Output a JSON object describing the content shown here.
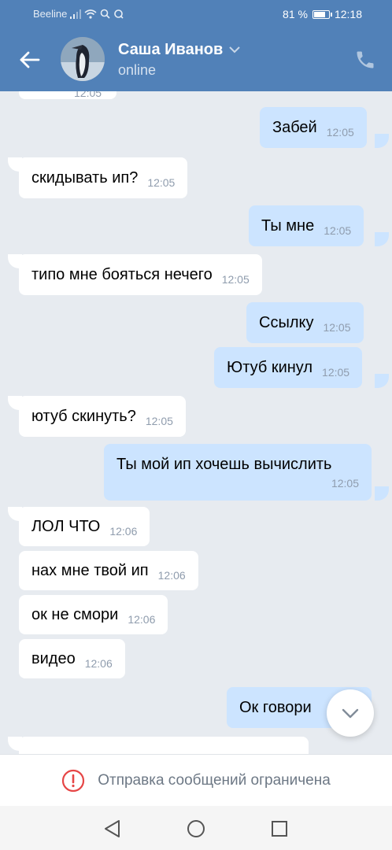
{
  "status_bar": {
    "carrier": "Beeline",
    "battery": "81 %",
    "battery_level": 0.81,
    "time": "12:18"
  },
  "header": {
    "contact_name": "Саша Иванов",
    "presence": "online",
    "icons": [
      "back-arrow-icon",
      "chevron-down-icon",
      "phone-icon"
    ]
  },
  "messages": [
    {
      "dir": "in",
      "text": "",
      "time": "12:05",
      "partial": true
    },
    {
      "dir": "out",
      "text": "Забей",
      "time": "12:05"
    },
    {
      "dir": "in",
      "text": "скидывать ип?",
      "time": "12:05"
    },
    {
      "dir": "out",
      "text": "Ты мне",
      "time": "12:05"
    },
    {
      "dir": "in",
      "text": "типо мне бояться нечего",
      "time": "12:05"
    },
    {
      "dir": "out",
      "text": "Ссылку",
      "time": "12:05"
    },
    {
      "dir": "out",
      "text": "Ютуб кинул",
      "time": "12:05"
    },
    {
      "dir": "in",
      "text": "ютуб скинуть?",
      "time": "12:05"
    },
    {
      "dir": "out",
      "text": "Ты мой ип хочешь вычислить",
      "time": "12:05"
    },
    {
      "dir": "in",
      "text": "ЛОЛ ЧТО",
      "time": "12:06"
    },
    {
      "dir": "in",
      "text": "нах мне твой ип",
      "time": "12:06"
    },
    {
      "dir": "in",
      "text": "ок не смори",
      "time": "12:06"
    },
    {
      "dir": "in",
      "text": "видео",
      "time": "12:06"
    },
    {
      "dir": "out",
      "text": "Ок говори",
      "time": ""
    },
    {
      "dir": "in",
      "text": "",
      "time": "",
      "partial": true
    }
  ],
  "composer": {
    "restricted_text": "Отправка сообщений ограничена"
  },
  "colors": {
    "header": "#5181b8",
    "background": "#e7ebf0",
    "incoming_bubble": "#ffffff",
    "outgoing_bubble": "#cce4ff",
    "warning": "#e64646"
  }
}
